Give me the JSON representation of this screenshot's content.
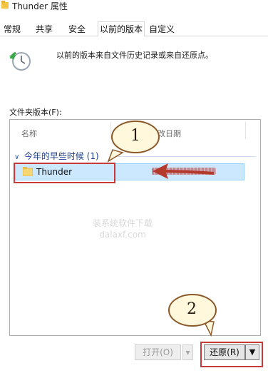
{
  "window": {
    "title": "Thunder 属性"
  },
  "tabs": [
    {
      "label": "常规"
    },
    {
      "label": "共享"
    },
    {
      "label": "安全"
    },
    {
      "label": "以前的版本"
    },
    {
      "label": "自定义"
    }
  ],
  "intro": {
    "text": "以前的版本来自文件历史记录或来自还原点。"
  },
  "folder_versions": {
    "label": "文件夹版本(F):",
    "columns": {
      "name": "名称",
      "date": "改日期"
    },
    "group": {
      "label": "今年的早些时候 (1)"
    },
    "rows": [
      {
        "name": "Thunder"
      }
    ]
  },
  "buttons": {
    "open": "打开(O)",
    "open_dropdown": "▾",
    "restore": "还原(R)",
    "restore_dropdown": "▼"
  },
  "callouts": {
    "one": "1",
    "two": "2"
  },
  "watermark": {
    "line1": "装系统软件下载",
    "line2": "dalaxf.com"
  },
  "colors": {
    "selection_bg": "#cce8ff",
    "highlight_red": "#c83a3a",
    "callout_fill": "#fff8dc"
  }
}
